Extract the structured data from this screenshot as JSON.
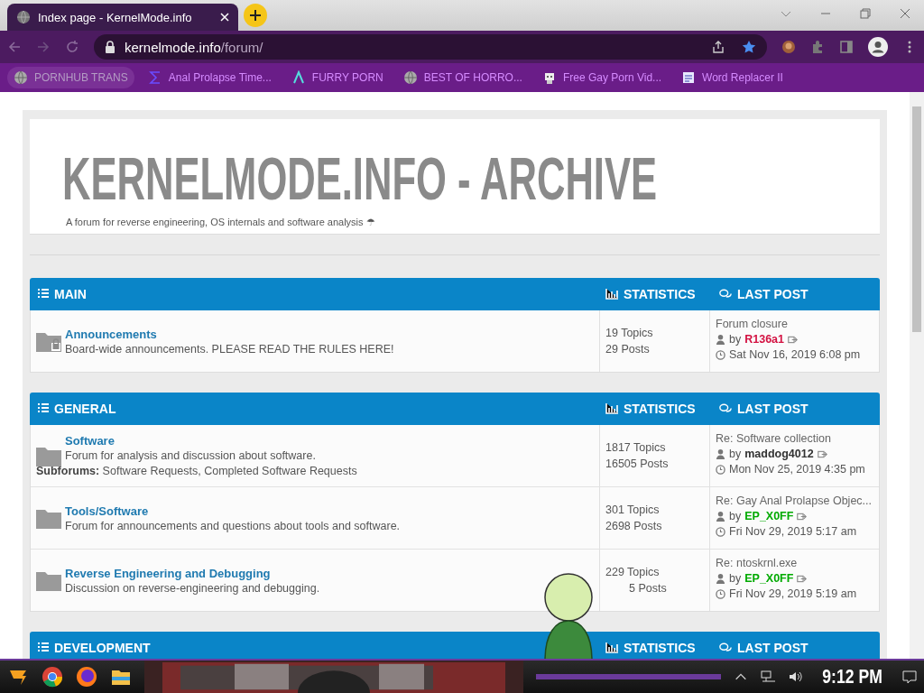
{
  "browser": {
    "tab_title": "Index page - KernelMode.info",
    "address_domain": "kernelmode.info",
    "address_path": "/forum/"
  },
  "bookmarks": [
    {
      "label": "PORNHUB TRANS",
      "kind": "globe"
    },
    {
      "label": "Anal Prolapse Time...",
      "kind": "sigma"
    },
    {
      "label": "FURRY PORN",
      "kind": "lambda"
    },
    {
      "label": "BEST OF HORRO...",
      "kind": "globe"
    },
    {
      "label": "Free Gay Porn Vid...",
      "kind": "robot"
    },
    {
      "label": "Word Replacer II",
      "kind": "wr"
    }
  ],
  "site": {
    "title": "KERNELMODE.INFO - ARCHIVE",
    "subtitle": "A forum for reverse engineering, OS internals and software analysis ☂"
  },
  "categories": [
    {
      "name": "MAIN",
      "stats_label": "STATISTICS",
      "last_post_label": "LAST POST",
      "forums": [
        {
          "title": "Announcements",
          "description": "Board-wide announcements. PLEASE READ THE RULES HERE!",
          "locked": true,
          "topics": "19 Topics",
          "posts": "29 Posts",
          "posts_covered": false,
          "last_title": "Forum closure",
          "by": "by",
          "author": "R136a1",
          "color": "#d31141",
          "date": "Sat Nov 16, 2019 6:08 pm"
        }
      ]
    },
    {
      "name": "GENERAL",
      "stats_label": "STATISTICS",
      "last_post_label": "LAST POST",
      "forums": [
        {
          "title": "Software",
          "description": "Forum for analysis and discussion about software.",
          "subforums_label": "Subforums:",
          "subforums": "Software Requests, Completed Software Requests",
          "locked": false,
          "topics": "1817 Topics",
          "posts": "16505 Posts",
          "posts_covered": false,
          "last_title": "Re: Software collection",
          "by": "by",
          "author": "maddog4012",
          "color": "#333333",
          "date": "Mon Nov 25, 2019 4:35 pm"
        },
        {
          "title": "Tools/Software",
          "description": "Forum for announcements and questions about tools and software.",
          "locked": false,
          "topics": "301 Topics",
          "posts": "2698 Posts",
          "posts_covered": false,
          "last_title": "Re: Gay Anal Prolapse Objec...",
          "by": "by",
          "author": "EP_X0FF",
          "color": "#00aa00",
          "date": "Fri Nov 29, 2019 5:17 am"
        },
        {
          "title": "Reverse Engineering and Debugging",
          "description": "Discussion on reverse-engineering and debugging.",
          "locked": false,
          "topics": "229 Topics",
          "posts": "5 Posts",
          "posts_covered": true,
          "last_title": "Re: ntoskrnl.exe",
          "by": "by",
          "author": "EP_X0FF",
          "color": "#00aa00",
          "date": "Fri Nov 29, 2019 5:19 am"
        }
      ]
    },
    {
      "name": "DEVELOPMENT",
      "stats_label": "STATISTICS",
      "last_post_label": "LAST POST"
    }
  ],
  "taskbar": {
    "time": "9:12 PM"
  }
}
